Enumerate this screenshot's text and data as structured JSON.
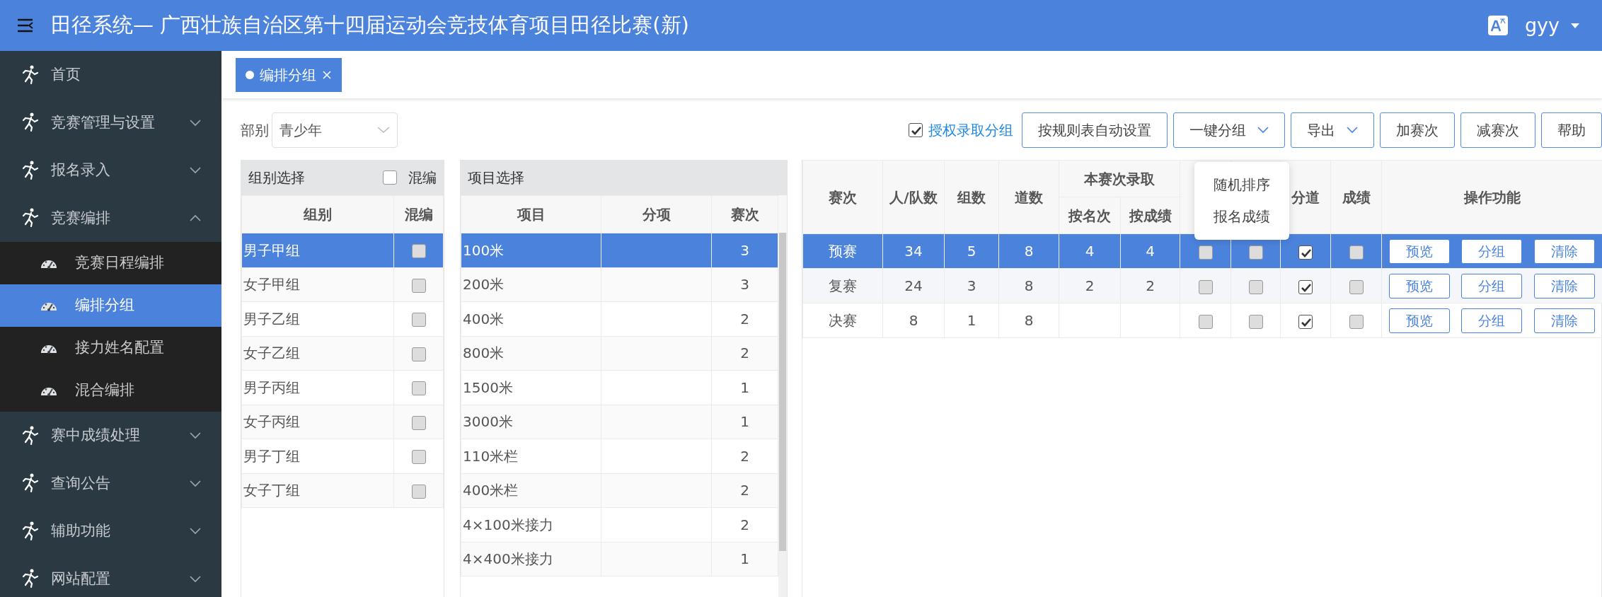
{
  "header": {
    "title": "田径系统— 广西壮族自治区第十四届运动会竞技体育项目田径比赛(新)",
    "user": "gyy"
  },
  "sidebar": {
    "items": [
      {
        "label": "首页",
        "kind": "link"
      },
      {
        "label": "竞赛管理与设置",
        "kind": "menu",
        "expanded": false
      },
      {
        "label": "报名录入",
        "kind": "menu",
        "expanded": false
      },
      {
        "label": "竞赛编排",
        "kind": "menu",
        "expanded": true,
        "children": [
          {
            "label": "竞赛日程编排",
            "selected": false
          },
          {
            "label": "编排分组",
            "selected": true
          },
          {
            "label": "接力姓名配置",
            "selected": false
          },
          {
            "label": "混合编排",
            "selected": false
          }
        ]
      },
      {
        "label": "赛中成绩处理",
        "kind": "menu",
        "expanded": false
      },
      {
        "label": "查询公告",
        "kind": "menu",
        "expanded": false
      },
      {
        "label": "辅助功能",
        "kind": "menu",
        "expanded": false
      },
      {
        "label": "网站配置",
        "kind": "menu",
        "expanded": false
      }
    ]
  },
  "tabs": [
    {
      "label": "编排分组",
      "selected": true
    }
  ],
  "filter": {
    "label": "部别",
    "value": "青少年"
  },
  "toolbar": {
    "authorize": {
      "label": "授权录取分组",
      "checked": true
    },
    "buttons": [
      {
        "label": "按规则表自动设置",
        "kind": "plain"
      },
      {
        "label": "一键分组",
        "kind": "dropdown",
        "menu": [
          "随机排序",
          "报名成绩"
        ]
      },
      {
        "label": "导出",
        "kind": "dropdown"
      },
      {
        "label": "加赛次",
        "kind": "plain"
      },
      {
        "label": "减赛次",
        "kind": "plain"
      },
      {
        "label": "帮助",
        "kind": "plain"
      }
    ]
  },
  "group_panel": {
    "title": "组别选择",
    "mix": {
      "label": "混编",
      "checked": false
    },
    "columns": [
      "组别",
      "混编"
    ],
    "rows": [
      {
        "group": "男子甲组",
        "mixed": false,
        "selected": true
      },
      {
        "group": "女子甲组",
        "mixed": false,
        "selected": false
      },
      {
        "group": "男子乙组",
        "mixed": false,
        "selected": false
      },
      {
        "group": "女子乙组",
        "mixed": false,
        "selected": false
      },
      {
        "group": "男子丙组",
        "mixed": false,
        "selected": false
      },
      {
        "group": "女子丙组",
        "mixed": false,
        "selected": false
      },
      {
        "group": "男子丁组",
        "mixed": false,
        "selected": false
      },
      {
        "group": "女子丁组",
        "mixed": false,
        "selected": false
      }
    ]
  },
  "event_panel": {
    "title": "项目选择",
    "columns": [
      "项目",
      "分项",
      "赛次"
    ],
    "rows": [
      {
        "event": "100米",
        "rounds": "3",
        "selected": true
      },
      {
        "event": "200米",
        "rounds": "3",
        "selected": false
      },
      {
        "event": "400米",
        "rounds": "2",
        "selected": false
      },
      {
        "event": "800米",
        "rounds": "2",
        "selected": false
      },
      {
        "event": "1500米",
        "rounds": "1",
        "selected": false
      },
      {
        "event": "3000米",
        "rounds": "1",
        "selected": false
      },
      {
        "event": "110米栏",
        "rounds": "2",
        "selected": false
      },
      {
        "event": "400米栏",
        "rounds": "2",
        "selected": false
      },
      {
        "event": "4×100米接力",
        "rounds": "2",
        "selected": false
      },
      {
        "event": "4×400米接力",
        "rounds": "1",
        "selected": false
      }
    ]
  },
  "rounds_table": {
    "columns": {
      "main": [
        "赛次",
        "人/队数",
        "组数",
        "道数"
      ],
      "admit": {
        "label": "本赛次录取",
        "sub": [
          "按名次",
          "按成绩"
        ]
      },
      "checks": [
        "分道",
        "成绩"
      ],
      "actions": "操作功能"
    },
    "rows": [
      {
        "round": "预赛",
        "count": "34",
        "groups": "5",
        "lanes": "8",
        "by_rank": "4",
        "by_score": "4",
        "checks": [
          false,
          false,
          true,
          false
        ],
        "actions": [
          "预览",
          "分组",
          "清除"
        ],
        "selected": true
      },
      {
        "round": "复赛",
        "count": "24",
        "groups": "3",
        "lanes": "8",
        "by_rank": "2",
        "by_score": "2",
        "checks": [
          false,
          false,
          true,
          false
        ],
        "actions": [
          "预览",
          "分组",
          "清除"
        ],
        "selected": false
      },
      {
        "round": "决赛",
        "count": "8",
        "groups": "1",
        "lanes": "8",
        "checks": [
          false,
          false,
          true,
          false
        ],
        "actions": [
          "预览",
          "分组",
          "清除"
        ],
        "selected": false
      }
    ]
  }
}
